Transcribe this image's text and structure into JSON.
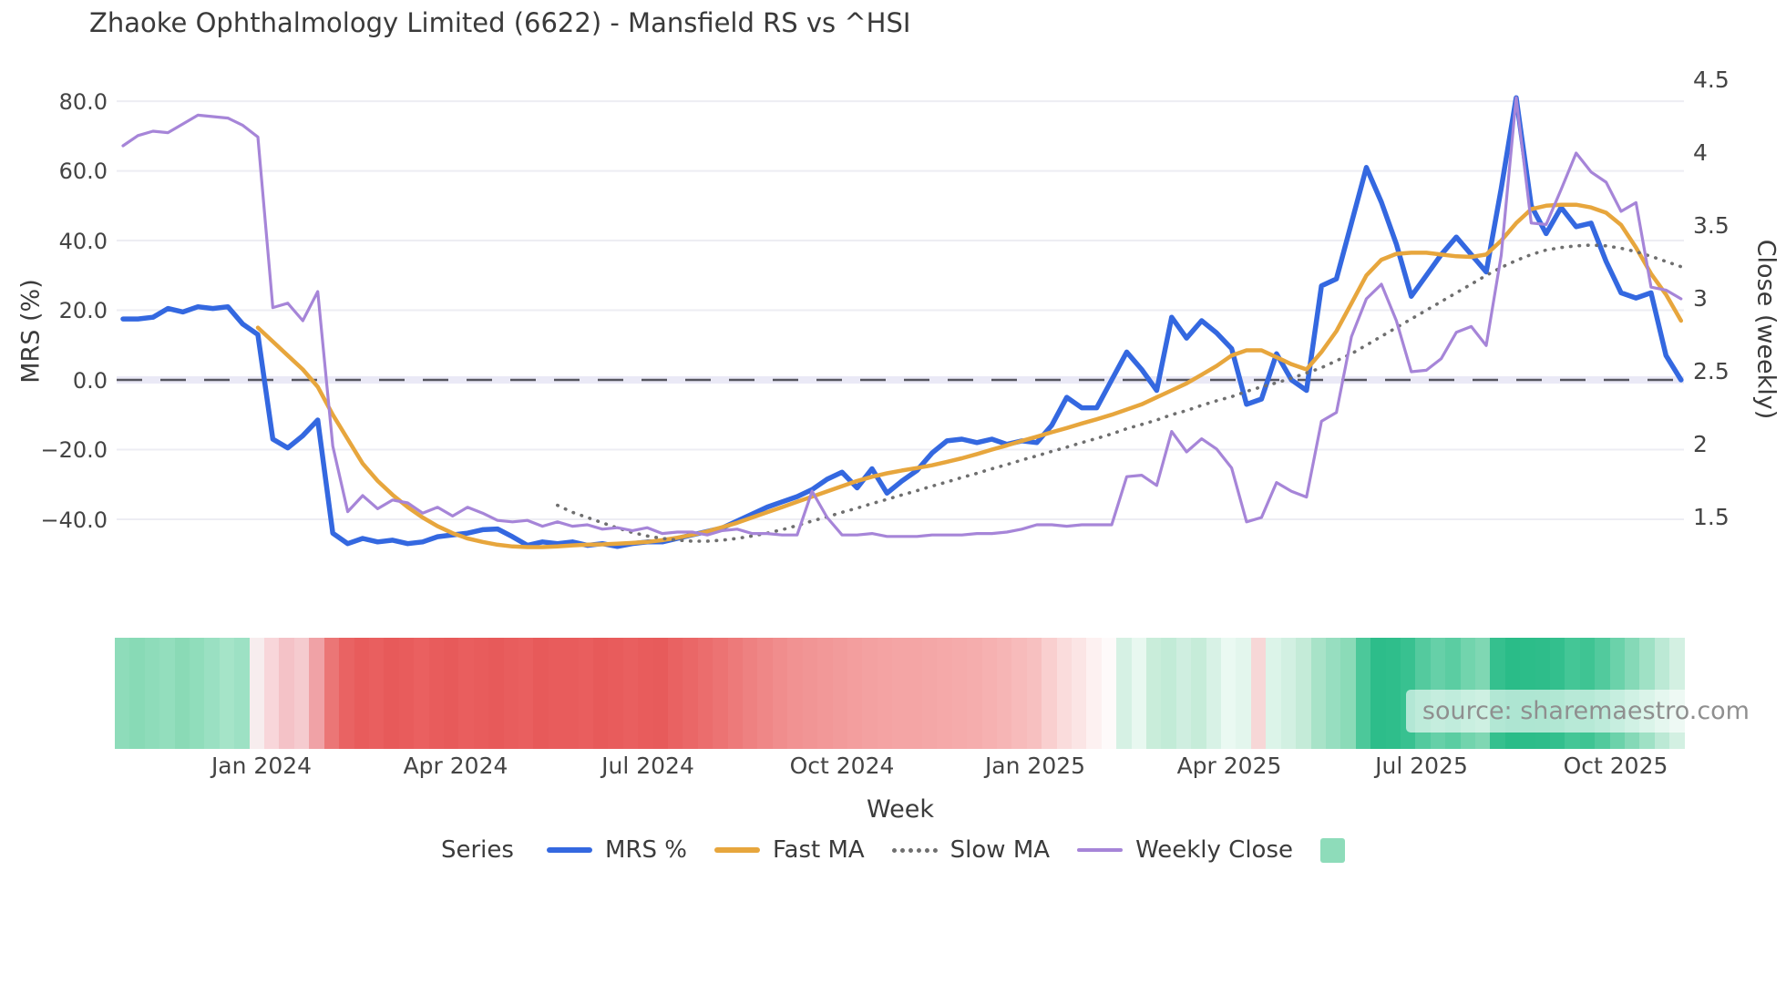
{
  "title": "Zhaoke Ophthalmology Limited (6622) - Mansfield RS vs ^HSI",
  "source_note": "source: sharemaestro.com",
  "legend": {
    "title": "Series",
    "heat_swatch_color": "#8edcba"
  },
  "chart_data": {
    "type": "line",
    "title": "Zhaoke Ophthalmology Limited (6622) - Mansfield RS vs ^HSI",
    "xlabel": "Week",
    "ylabel_left": "MRS (%)",
    "ylabel_right": "Close (weekly)",
    "grid": true,
    "legend_position": "bottom",
    "n_points": 105,
    "xticks": [
      "Jan 2024",
      "Apr 2024",
      "Jul 2024",
      "Oct 2024",
      "Jan 2025",
      "Apr 2025",
      "Jul 2025",
      "Oct 2025"
    ],
    "yticks_left": [
      "80.0",
      "60.0",
      "40.0",
      "20.0",
      "0.0",
      "−20.0",
      "−40.0"
    ],
    "yticks_right": [
      "4.5",
      "4",
      "3.5",
      "3",
      "2.5",
      "2",
      "1.5"
    ],
    "ylim_left": [
      -55,
      88
    ],
    "ylim_right": [
      1.3,
      4.5
    ],
    "zero_line_left_axis": 0,
    "series": [
      {
        "name": "MRS %",
        "axis": "left",
        "color": "#3468e0",
        "line_style": "solid",
        "values": [
          17.5,
          17.5,
          18,
          20.5,
          19.5,
          21,
          20.5,
          21,
          16,
          13,
          -17,
          -19.5,
          -16,
          -11.5,
          -44,
          -47,
          -45.5,
          -46.5,
          -46,
          -47,
          -46.5,
          -45,
          -44.5,
          -44,
          -43,
          -42.8,
          -45,
          -47.5,
          -46.5,
          -47,
          -46.5,
          -47.5,
          -47,
          -47.8,
          -47,
          -46.5,
          -46.5,
          -45.5,
          -44.5,
          -43.5,
          -42.5,
          -40.5,
          -38.5,
          -36.5,
          -35,
          -33.5,
          -31.5,
          -28.5,
          -26.5,
          -31,
          -25.5,
          -32.5,
          -29,
          -26,
          -21,
          -17.5,
          -17,
          -18,
          -17,
          -18.5,
          -17.5,
          -18,
          -13,
          -5,
          -8,
          -8,
          0,
          8,
          3,
          -3,
          18,
          12,
          17,
          13.5,
          9,
          -7,
          -5.5,
          7.5,
          0,
          -3,
          27,
          29,
          45,
          61,
          51,
          39,
          24,
          30,
          36,
          41,
          36,
          31,
          55,
          81,
          50,
          42,
          49.5,
          44,
          45,
          34,
          25,
          23.5,
          25,
          7,
          0
        ]
      },
      {
        "name": "Fast MA",
        "axis": "left",
        "color": "#e7a63d",
        "line_style": "solid",
        "values": [
          null,
          null,
          null,
          null,
          null,
          null,
          null,
          null,
          null,
          15,
          11,
          7,
          3,
          -2,
          -10,
          -17,
          -24,
          -29,
          -33,
          -36.5,
          -39.5,
          -42,
          -44,
          -45.5,
          -46.5,
          -47.3,
          -47.8,
          -48,
          -48,
          -47.8,
          -47.5,
          -47.3,
          -47.2,
          -47,
          -46.8,
          -46.5,
          -46,
          -45.3,
          -44.5,
          -43.5,
          -42.3,
          -41,
          -39.5,
          -38,
          -36.5,
          -35,
          -33.5,
          -32,
          -30.5,
          -29,
          -27.8,
          -26.8,
          -26,
          -25.3,
          -24.5,
          -23.5,
          -22.5,
          -21.3,
          -20,
          -18.8,
          -17.5,
          -16.3,
          -15,
          -13.8,
          -12.5,
          -11.3,
          -10,
          -8.5,
          -7,
          -5,
          -3,
          -1,
          1.5,
          4,
          7,
          8.5,
          8.5,
          6.5,
          4.5,
          3,
          8,
          14,
          22,
          30,
          34.5,
          36.2,
          36.5,
          36.5,
          36,
          35.5,
          35.3,
          36,
          40,
          45,
          49,
          50,
          50.3,
          50.3,
          49.5,
          48,
          44.5,
          38,
          30.5,
          24.5,
          17
        ]
      },
      {
        "name": "Slow MA",
        "axis": "left",
        "color": "#6f6f6f",
        "line_style": "dotted",
        "values": [
          null,
          null,
          null,
          null,
          null,
          null,
          null,
          null,
          null,
          null,
          null,
          null,
          null,
          null,
          null,
          null,
          null,
          null,
          null,
          null,
          null,
          null,
          null,
          null,
          null,
          null,
          null,
          null,
          null,
          -36,
          -38,
          -39.5,
          -41,
          -42.5,
          -43.8,
          -44.8,
          -45.5,
          -46,
          -46.3,
          -46.3,
          -46,
          -45.5,
          -44.8,
          -44,
          -43,
          -41.8,
          -40.5,
          -39.3,
          -38,
          -36.8,
          -35.5,
          -34.3,
          -33,
          -31.8,
          -30.5,
          -29.3,
          -28,
          -26.8,
          -25.5,
          -24.3,
          -23,
          -21.8,
          -20.5,
          -19.3,
          -18,
          -16.8,
          -15.5,
          -14,
          -12.8,
          -11.5,
          -10,
          -8.8,
          -7.3,
          -6,
          -4.8,
          -3.3,
          -2,
          -0.8,
          0.5,
          2,
          3.5,
          5.5,
          7.5,
          10,
          12.5,
          15,
          17.5,
          20,
          22.5,
          25,
          27.5,
          30,
          32.3,
          34.3,
          36,
          37.3,
          38,
          38.5,
          38.7,
          38.5,
          37.8,
          36.8,
          35.5,
          34,
          32.5
        ]
      },
      {
        "name": "Weekly Close",
        "axis": "right",
        "color": "#a685d8",
        "line_style": "solid",
        "values": [
          4.05,
          4.12,
          4.15,
          4.14,
          4.2,
          4.26,
          4.25,
          4.24,
          4.19,
          4.11,
          2.94,
          2.97,
          2.85,
          3.05,
          1.99,
          1.54,
          1.65,
          1.56,
          1.62,
          1.6,
          1.53,
          1.57,
          1.51,
          1.57,
          1.53,
          1.48,
          1.47,
          1.48,
          1.44,
          1.47,
          1.44,
          1.45,
          1.42,
          1.43,
          1.41,
          1.43,
          1.39,
          1.4,
          1.4,
          1.38,
          1.41,
          1.42,
          1.39,
          1.39,
          1.38,
          1.38,
          1.68,
          1.5,
          1.38,
          1.38,
          1.39,
          1.37,
          1.37,
          1.37,
          1.38,
          1.38,
          1.38,
          1.39,
          1.39,
          1.4,
          1.42,
          1.45,
          1.45,
          1.44,
          1.45,
          1.45,
          1.45,
          1.78,
          1.79,
          1.72,
          2.09,
          1.95,
          2.04,
          1.97,
          1.84,
          1.47,
          1.5,
          1.74,
          1.68,
          1.64,
          2.16,
          2.22,
          2.74,
          3.0,
          3.1,
          2.85,
          2.5,
          2.51,
          2.59,
          2.77,
          2.81,
          2.68,
          3.3,
          4.38,
          3.52,
          3.51,
          3.75,
          4.0,
          3.87,
          3.8,
          3.6,
          3.66,
          3.08,
          3.06,
          3.0
        ]
      }
    ],
    "heatmap_colors": [
      "#8edcba",
      "#88dab6",
      "#8edcba",
      "#93debd",
      "#8adab6",
      "#90ddbb",
      "#9ae0c2",
      "#a5e4c8",
      "#9de1c4",
      "#f7edee",
      "#f8d6da",
      "#f4c2c7",
      "#f5cbcf",
      "#f0a2a6",
      "#eb7676",
      "#e96363",
      "#e85c5c",
      "#e95f5f",
      "#e75a5a",
      "#e85c5c",
      "#ea6060",
      "#e85c5c",
      "#e75a5a",
      "#e95e5e",
      "#e85c5c",
      "#e75a5a",
      "#e85d5d",
      "#e95f5f",
      "#e75a5a",
      "#e85c5c",
      "#e85c5c",
      "#e95e5e",
      "#e75a5a",
      "#e85c5c",
      "#e95f5f",
      "#e85c5c",
      "#e75b5b",
      "#e96262",
      "#ea6767",
      "#eb6d6d",
      "#ec7373",
      "#ed7a7a",
      "#ee8181",
      "#ef8787",
      "#f08d8d",
      "#f19292",
      "#f19595",
      "#f29898",
      "#f29b9b",
      "#f39e9e",
      "#f3a1a1",
      "#f4a3a3",
      "#f4a5a5",
      "#f4a5a5",
      "#f4a7a7",
      "#f5a9a9",
      "#f5abab",
      "#f5adad",
      "#f6b1b1",
      "#f6b5b5",
      "#f7bbbb",
      "#f7c0c0",
      "#f9cfcf",
      "#fadcdc",
      "#fbe5e5",
      "#fdf1f1",
      "#fefafa",
      "#d6f1e4",
      "#e8f8f0",
      "#c9edda",
      "#c2ebd7",
      "#cfeee0",
      "#c6ecd9",
      "#d8f2e6",
      "#eaf9f2",
      "#e3f6ed",
      "#f7d7d7",
      "#dcf4e9",
      "#d2f0e2",
      "#c4ebd8",
      "#a8e3c8",
      "#97dec0",
      "#8bdbb8",
      "#4cc89a",
      "#2dbd8a",
      "#2fbe8b",
      "#38c190",
      "#54ca9e",
      "#66d0a8",
      "#5bcda2",
      "#72d4ad",
      "#7fd7b3",
      "#35c08e",
      "#2abc88",
      "#2cbd89",
      "#2ebd8a",
      "#33bf8d",
      "#44c696",
      "#3fc493",
      "#52ca9d",
      "#6bd2aa",
      "#85d9b7",
      "#9fe1c5",
      "#bce9d5",
      "#d3f0e2"
    ]
  }
}
